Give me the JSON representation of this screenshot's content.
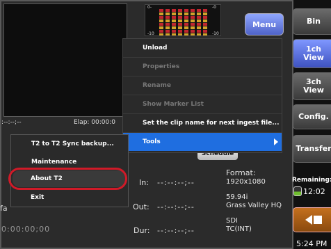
{
  "top_menu": {
    "menu_label": "Menu"
  },
  "meter": {
    "tick_0_left": "0-",
    "tick_0_right": "-0",
    "tick_10_left": "-10",
    "tick_10_right": "-10"
  },
  "timecodes": {
    "left_small": ":--:--;--",
    "elap_label": "Elap: 00:00:0",
    "in_label": "In:",
    "in_value": "--:--:--;--",
    "out_label": "Out:",
    "out_value": "--:--:--;--",
    "dur_label": "Dur:",
    "dur_value": "--:--:--;--",
    "left_tc": "0:00:00;00",
    "fa": "fa"
  },
  "format": {
    "title": "Format:",
    "resolution": "1920x1080",
    "rate": "59.94i",
    "codec": "Grass Valley HQ",
    "input": "SDI",
    "tc": "TC(INT)"
  },
  "schedule_label": "Schedule",
  "dropdown": {
    "items": [
      {
        "label": "Unload",
        "enabled": true
      },
      {
        "label": "Properties",
        "enabled": false
      },
      {
        "label": "Rename",
        "enabled": false
      },
      {
        "label": "Show Marker List",
        "enabled": false
      },
      {
        "label": "Set the clip name for next ingest file...",
        "enabled": true
      },
      {
        "label": "Tools",
        "enabled": true,
        "active": true
      }
    ]
  },
  "submenu": {
    "items": [
      {
        "label": "T2 to T2 Sync backup..."
      },
      {
        "label": "Maintenance"
      },
      {
        "label": "About T2"
      },
      {
        "label": "Exit"
      }
    ]
  },
  "right_panel": {
    "bin": "Bin",
    "view1_line1": "1ch",
    "view1_line2": "View",
    "view3_line1": "3ch",
    "view3_line2": "View",
    "config": "Config.",
    "transfer": "Transfer",
    "remaining_label": "Remaining:",
    "remaining_value": "12:02",
    "clock": "5:24 PM"
  },
  "colors": {
    "accent_blue": "#1f6ee0",
    "highlight_red": "#d01a28",
    "eject_orange": "#c4701e"
  }
}
